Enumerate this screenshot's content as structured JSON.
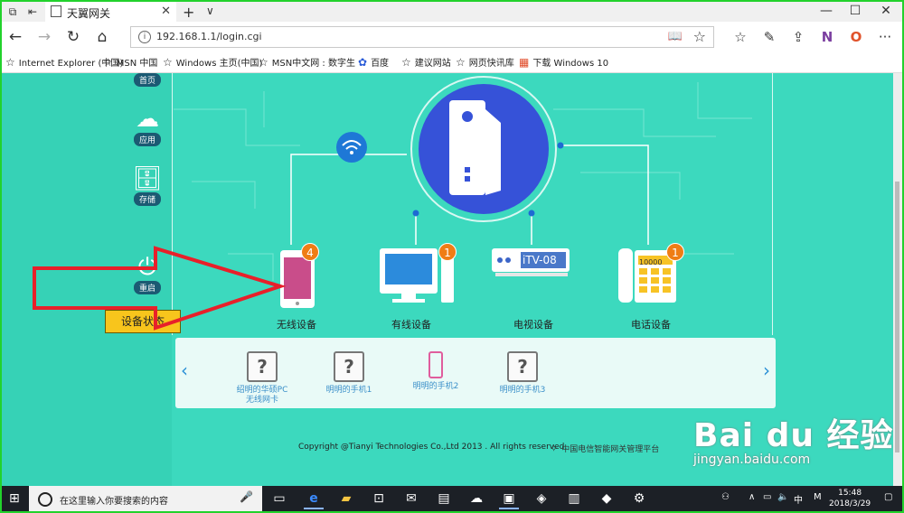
{
  "browser": {
    "tab_title": "天翼网关",
    "url": "192.168.1.1/login.cgi"
  },
  "favorites": [
    "Internet Explorer (中国)",
    "MSN 中国",
    "Windows 主页(中国)",
    "MSN中文网 : 数字生",
    "百度",
    "建议网站",
    "网页快讯库",
    "下载 Windows 10"
  ],
  "sidebar": {
    "items": [
      {
        "label": "首页",
        "icon": "home-icon"
      },
      {
        "label": "应用",
        "icon": "cloud-icon"
      },
      {
        "label": "存储",
        "icon": "storage-icon"
      },
      {
        "label": "重启",
        "icon": "power-icon"
      }
    ],
    "status_button": "设备状态"
  },
  "topology": {
    "devices": [
      {
        "label": "无线设备",
        "count": "4"
      },
      {
        "label": "有线设备",
        "count": "1"
      },
      {
        "label": "电视设备",
        "stb_model": "iTV-08"
      },
      {
        "label": "电话设备",
        "count": "1",
        "phone_number": "10000"
      }
    ]
  },
  "device_list": [
    {
      "name": "绍明的华硕PC无线网卡",
      "type": "unknown"
    },
    {
      "name": "明明的手机1",
      "type": "unknown"
    },
    {
      "name": "明明的手机2",
      "type": "phone"
    },
    {
      "name": "明明的手机3",
      "type": "unknown"
    }
  ],
  "footer": {
    "copyright": "Copyright @Tianyi Technologies Co.,Ltd 2013 . All rights reserved.",
    "platform": "中国电信智能网关管理平台"
  },
  "watermark": {
    "brand": "Bai du 经验",
    "url": "jingyan.baidu.com"
  },
  "taskbar": {
    "search_placeholder": "在这里输入你要搜索的内容",
    "ime": "中",
    "ime2": "M",
    "time": "15:48",
    "date": "2018/3/29"
  },
  "colors": {
    "page_bg": "#3cd9be",
    "accent_blue": "#3652d8",
    "badge": "#ef7d15",
    "status_button": "#f8c51c",
    "arrow": "#e8202a"
  }
}
